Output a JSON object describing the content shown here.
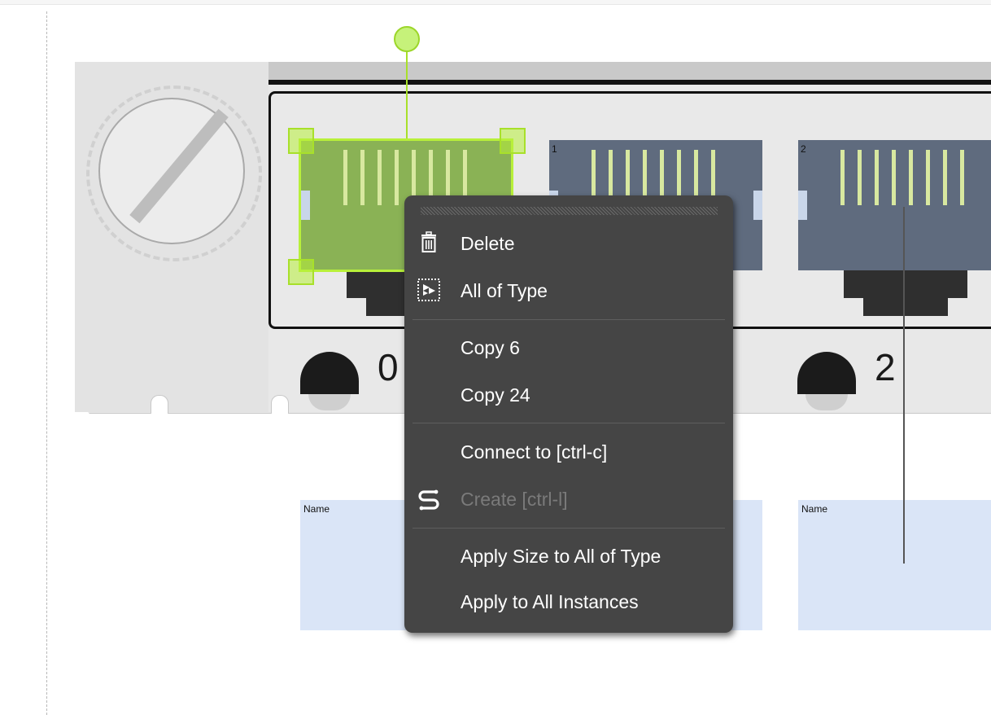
{
  "ports": [
    {
      "number": "",
      "label": "0",
      "name_label": "Name"
    },
    {
      "number": "1",
      "label": "",
      "name_label": ""
    },
    {
      "number": "2",
      "label": "2",
      "name_label": "Name"
    }
  ],
  "context_menu": {
    "items": [
      {
        "label": "Delete",
        "icon": "trash-icon",
        "enabled": true
      },
      {
        "label": "All of Type",
        "icon": "select-all-icon",
        "enabled": true
      },
      {
        "label": "Copy 6",
        "enabled": true
      },
      {
        "label": "Copy 24",
        "enabled": true
      },
      {
        "label": "Connect to [ctrl-c]",
        "enabled": true
      },
      {
        "label": "Create [ctrl-l]",
        "icon": "link-icon",
        "enabled": false
      },
      {
        "label": "Apply Size to All of Type",
        "enabled": true
      },
      {
        "label": "Apply to All Instances",
        "enabled": true
      }
    ]
  },
  "colors": {
    "selected_port": "#8ab255",
    "port": "#5f6b7e",
    "selection": "#b8f03a",
    "menu_bg": "#454545",
    "name_box": "#dae5f7"
  }
}
